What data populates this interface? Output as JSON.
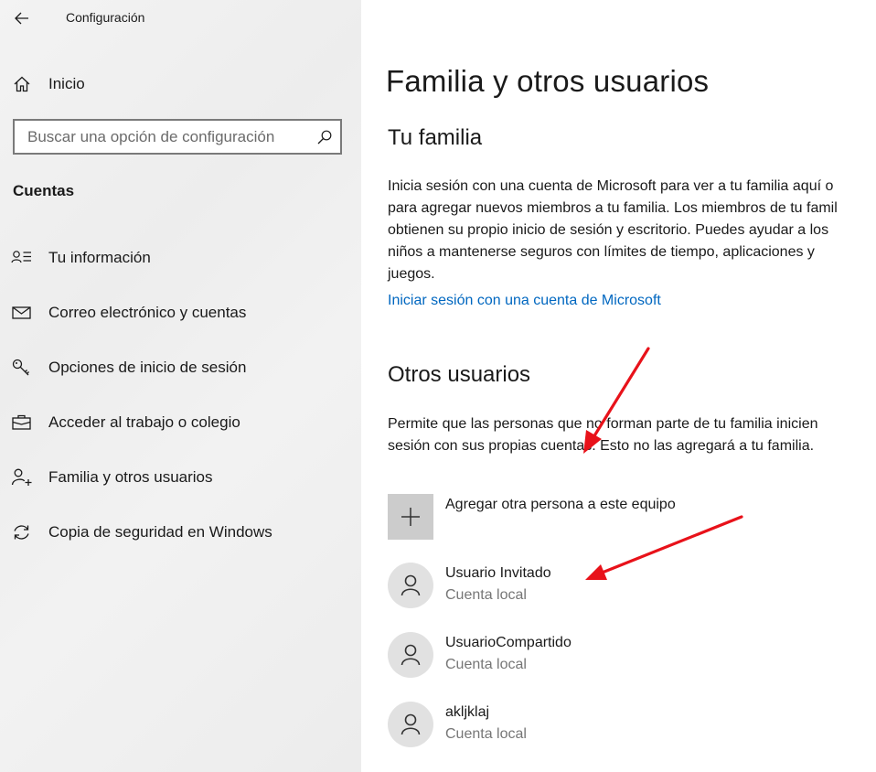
{
  "window": {
    "title": "Configuración"
  },
  "sidebar": {
    "home_label": "Inicio",
    "search": {
      "placeholder": "Buscar una opción de configuración"
    },
    "section_title": "Cuentas",
    "items": [
      {
        "label": "Tu información",
        "icon": "contact-info-icon"
      },
      {
        "label": "Correo electrónico y cuentas",
        "icon": "mail-icon"
      },
      {
        "label": "Opciones de inicio de sesión",
        "icon": "key-icon"
      },
      {
        "label": "Acceder al trabajo o colegio",
        "icon": "briefcase-icon"
      },
      {
        "label": "Familia y otros usuarios",
        "icon": "add-person-icon"
      },
      {
        "label": "Copia de seguridad en Windows",
        "icon": "sync-icon"
      }
    ]
  },
  "main": {
    "title": "Familia y otros usuarios",
    "family": {
      "heading": "Tu familia",
      "description_lines": [
        "Inicia sesión con una cuenta de Microsoft para ver a tu familia aquí o",
        "para agregar nuevos miembros a tu familia. Los miembros de tu famil",
        "obtienen su propio inicio de sesión y escritorio. Puedes ayudar a los",
        "niños a mantenerse seguros con límites de tiempo, aplicaciones y",
        "juegos."
      ],
      "link": "Iniciar sesión con una cuenta de Microsoft"
    },
    "others": {
      "heading": "Otros usuarios",
      "description_lines": [
        "Permite que las personas que no forman parte de tu familia inicien",
        "sesión con sus propias cuentas. Esto no las agregará a tu familia."
      ],
      "add_label": "Agregar otra persona a este equipo",
      "users": [
        {
          "name": "Usuario Invitado",
          "type": "Cuenta local"
        },
        {
          "name": "UsuarioCompartido",
          "type": "Cuenta local"
        },
        {
          "name": "akljklaj",
          "type": "Cuenta local"
        }
      ]
    }
  },
  "colors": {
    "link": "#0067c0",
    "annotation_arrow": "#e8121a",
    "sidebar_bg": "#efefef",
    "tile_bg": "#cccccc"
  }
}
